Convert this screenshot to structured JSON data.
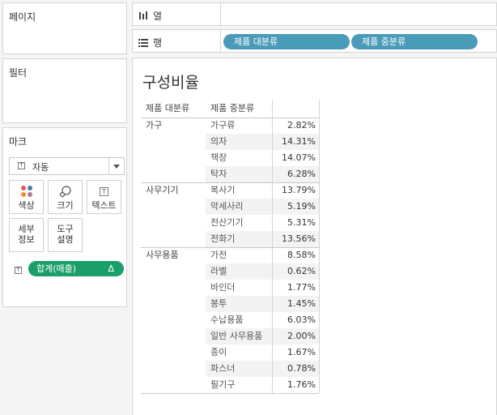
{
  "panels": {
    "pages_title": "페이지",
    "filters_title": "필터",
    "marks_title": "마크"
  },
  "marks": {
    "type_label": "자동",
    "buttons": {
      "color": "색상",
      "size": "크기",
      "label": "텍스트",
      "detail": "세부\n정보",
      "tooltip": "도구\n설명"
    },
    "pill_label": "합계(매출)",
    "pill_delta": "Δ"
  },
  "shelves": {
    "columns_label": "열",
    "rows_label": "행",
    "row_pills": [
      "제품 대분류",
      "제품 중분류"
    ]
  },
  "view": {
    "title": "구성비율",
    "headers": [
      "제품 대분류",
      "제품 중분류"
    ],
    "groups": [
      {
        "category": "가구",
        "rows": [
          {
            "sub": "가구류",
            "value": "2.82%"
          },
          {
            "sub": "의자",
            "value": "14.31%"
          },
          {
            "sub": "책장",
            "value": "14.07%"
          },
          {
            "sub": "탁자",
            "value": "6.28%"
          }
        ]
      },
      {
        "category": "사무기기",
        "rows": [
          {
            "sub": "복사기",
            "value": "13.79%"
          },
          {
            "sub": "악세사리",
            "value": "5.19%"
          },
          {
            "sub": "전산기기",
            "value": "5.31%"
          },
          {
            "sub": "전화기",
            "value": "13.56%"
          }
        ]
      },
      {
        "category": "사무용품",
        "rows": [
          {
            "sub": "가전",
            "value": "8.58%"
          },
          {
            "sub": "라벨",
            "value": "0.62%"
          },
          {
            "sub": "바인더",
            "value": "1.77%"
          },
          {
            "sub": "봉투",
            "value": "1.45%"
          },
          {
            "sub": "수납용품",
            "value": "6.03%"
          },
          {
            "sub": "일반 사무용품",
            "value": "2.00%"
          },
          {
            "sub": "종이",
            "value": "1.67%"
          },
          {
            "sub": "파스너",
            "value": "0.78%"
          },
          {
            "sub": "필기구",
            "value": "1.76%"
          }
        ]
      }
    ]
  },
  "colors": {
    "row_pill": "#4a9bb8",
    "measure_pill": "#1a9f6a",
    "band": "#f3f3f3"
  }
}
